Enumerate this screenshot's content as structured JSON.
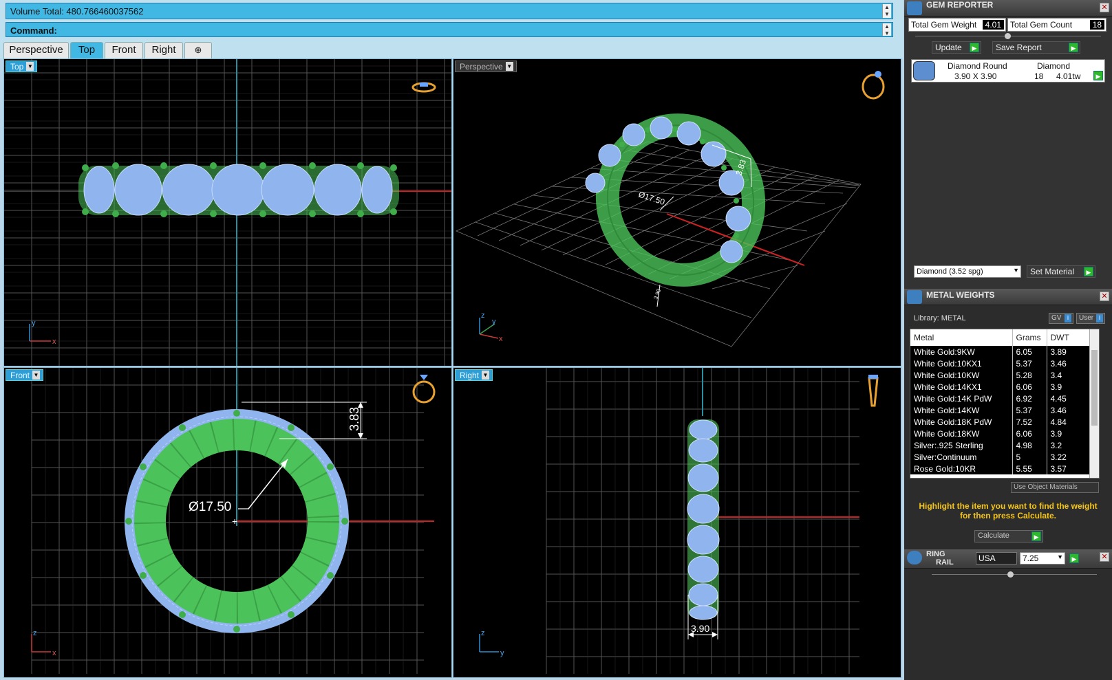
{
  "command": {
    "volume_line": "Volume Total: 480.766460037562",
    "command_label": "Command:"
  },
  "tabs": [
    {
      "label": "Perspective",
      "active": false
    },
    {
      "label": "Top",
      "active": true
    },
    {
      "label": "Front",
      "active": false
    },
    {
      "label": "Right",
      "active": false
    },
    {
      "label": "⊕",
      "active": false
    }
  ],
  "viewports": {
    "top": {
      "label": "Top",
      "axis_a": "y",
      "axis_b": "x"
    },
    "perspective": {
      "label": "Perspective",
      "axis_a": "z",
      "axis_b": "y",
      "axis_c": "x",
      "dim_diameter": "Ø17.50",
      "dim_height": "3.83",
      "dim_width": "3.90"
    },
    "front": {
      "label": "Front",
      "axis_a": "z",
      "axis_b": "x",
      "dim_diameter": "Ø17.50",
      "dim_height": "3.83"
    },
    "right": {
      "label": "Right",
      "axis_a": "z",
      "axis_b": "y",
      "dim_width": "3.90"
    }
  },
  "gem_reporter": {
    "title": "GEM REPORTER",
    "total_weight_label": "Total Gem Weight",
    "total_weight_value": "4.01",
    "total_count_label": "Total Gem Count",
    "total_count_value": "18",
    "update_label": "Update",
    "save_report_label": "Save Report",
    "gem_name": "Diamond Round",
    "gem_size": "3.90 X 3.90",
    "gem_material": "Diamond",
    "gem_count": "18",
    "gem_tw": "4.01tw",
    "material_select": "Diamond    (3.52 spg)",
    "set_material_label": "Set Material"
  },
  "metal_weights": {
    "title": "METAL WEIGHTS",
    "library": "Library: METAL",
    "gv_label": "GV",
    "user_label": "User",
    "columns": [
      "Metal",
      "Grams",
      "DWT"
    ],
    "rows": [
      [
        "White Gold:9KW",
        "6.05",
        "3.89"
      ],
      [
        "White Gold:10KX1",
        "5.37",
        "3.46"
      ],
      [
        "White Gold:10KW",
        "5.28",
        "3.4"
      ],
      [
        "White Gold:14KX1",
        "6.06",
        "3.9"
      ],
      [
        "White Gold:14K PdW",
        "6.92",
        "4.45"
      ],
      [
        "White Gold:14KW",
        "5.37",
        "3.46"
      ],
      [
        "White Gold:18K PdW",
        "7.52",
        "4.84"
      ],
      [
        "White Gold:18KW",
        "6.06",
        "3.9"
      ],
      [
        "Silver:.925 Sterling",
        "4.98",
        "3.2"
      ],
      [
        "Silver:Continuum",
        "5",
        "3.22"
      ],
      [
        "Rose Gold:10KR",
        "5.55",
        "3.57"
      ]
    ],
    "use_object_materials": "Use Object Materials",
    "hint": "Highlight the item you want to find the weight for then press Calculate.",
    "calculate_label": "Calculate"
  },
  "ring_rail": {
    "title_a": "RING",
    "title_b": "RAIL",
    "region": "USA",
    "size": "7.25"
  },
  "colors": {
    "gem_blue": "#8fb4ee",
    "metal_green": "#4cc35a",
    "grid": "#5a5a5a",
    "axis_red": "#cc2222",
    "axis_teal": "#2a8fa0",
    "hint_yellow": "#f5c518",
    "accent_blue": "#41b8e4"
  }
}
